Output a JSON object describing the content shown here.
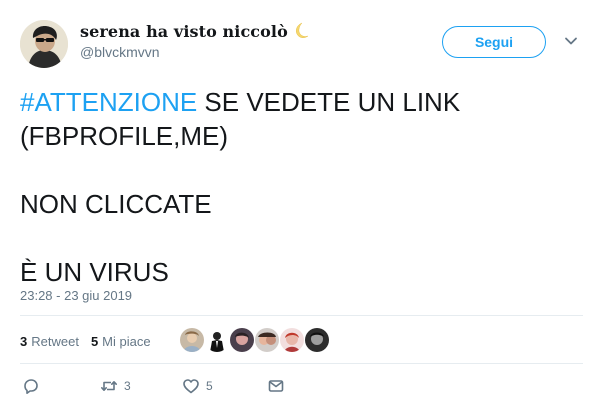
{
  "user": {
    "display_name": "serena ha visto niccolò",
    "handle": "@blvckmvvn",
    "avatar_icon": "user-avatar",
    "name_emoji_icon": "crescent-moon-icon"
  },
  "header": {
    "follow_label": "Segui",
    "menu_icon": "chevron-down-icon"
  },
  "tweet": {
    "hashtag": "#ATTENZIONE",
    "line1_rest": " SE VEDETE UN LINK",
    "line2": "(FBPROFILE,ME)",
    "line3": "NON CLICCATE",
    "line4": "È UN VIRUS",
    "timestamp": "23:28 - 23 giu 2019"
  },
  "stats": {
    "retweets_count": "3",
    "retweets_label": "Retweet",
    "likes_count": "5",
    "likes_label": "Mi piace"
  },
  "actions": {
    "reply_icon": "reply-icon",
    "retweet_icon": "retweet-icon",
    "retweet_count": "3",
    "like_icon": "heart-icon",
    "like_count": "5",
    "dm_icon": "envelope-icon"
  },
  "colors": {
    "accent": "#1da1f2",
    "secondary_text": "#657786",
    "divider": "#e6ecf0"
  }
}
